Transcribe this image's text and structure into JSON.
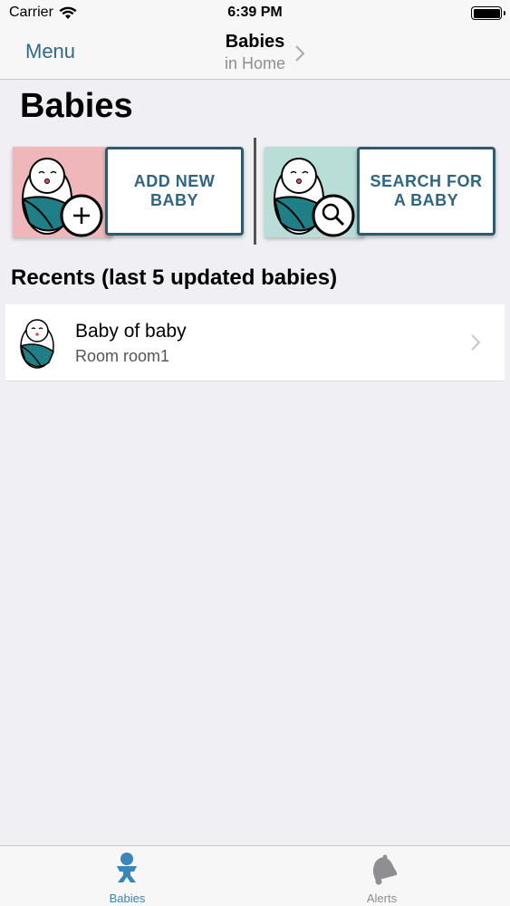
{
  "status_bar": {
    "carrier": "Carrier",
    "time": "6:39 PM"
  },
  "nav": {
    "menu_label": "Menu",
    "title": "Babies",
    "subtitle": "in Home"
  },
  "page": {
    "title": "Babies"
  },
  "actions": {
    "add_label": "ADD NEW\nBABY",
    "search_label": "SEARCH FOR\nA BABY"
  },
  "recents": {
    "header": "Recents (last 5 updated babies)",
    "items": [
      {
        "name": "Baby of baby",
        "room": "Room room1"
      }
    ]
  },
  "tabs": [
    {
      "label": "Babies",
      "selected": true
    },
    {
      "label": "Alerts",
      "selected": false
    }
  ],
  "colors": {
    "accent": "#2f6a8a",
    "tab_active": "#3a86b8",
    "tile_pink": "#f0b7bb",
    "tile_teal": "#b9ddd7",
    "baby_blanket": "#1f7f86"
  }
}
